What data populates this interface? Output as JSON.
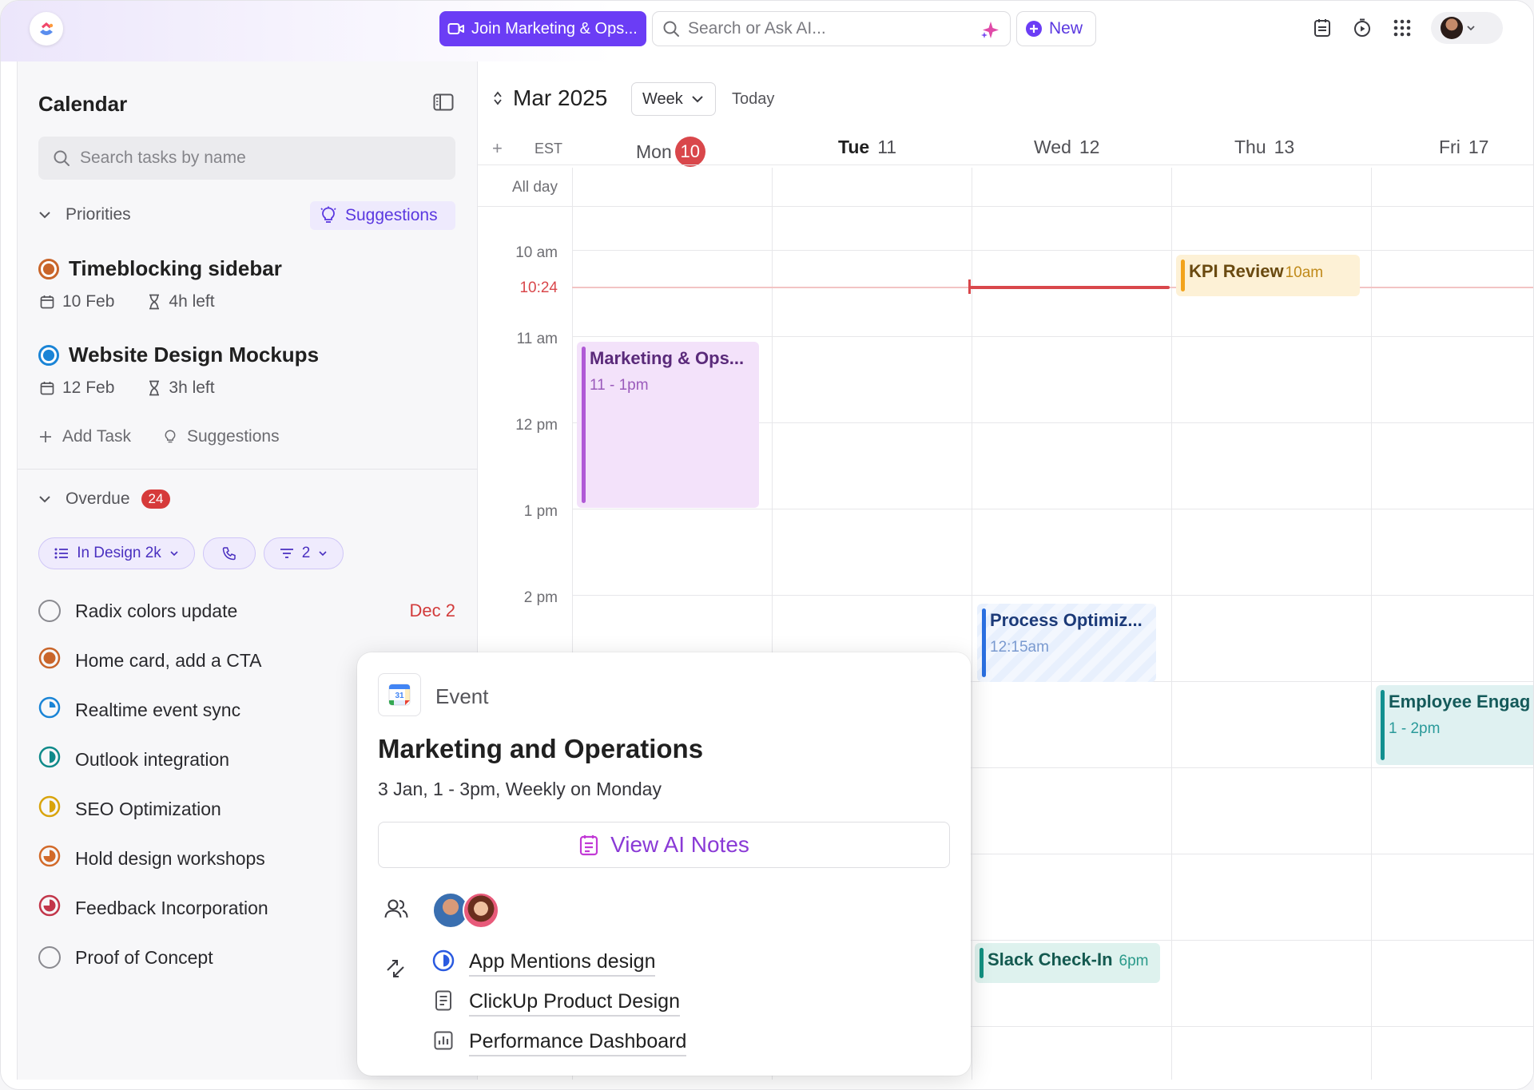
{
  "topbar": {
    "join_label": "Join Marketing & Ops...",
    "search_placeholder": "Search or Ask AI...",
    "new_label": "New",
    "accent": "#6b3df5"
  },
  "sidebar": {
    "title": "Calendar",
    "search_placeholder": "Search tasks by name",
    "priorities_label": "Priorities",
    "suggestions_label": "Suggestions",
    "priorities": [
      {
        "title": "Timeblocking sidebar",
        "date": "10 Feb",
        "left": "4h left",
        "status_color": "#c9652a"
      },
      {
        "title": "Website Design Mockups",
        "date": "12 Feb",
        "left": "3h left",
        "status_color": "#1a84d6"
      }
    ],
    "add_task_label": "Add Task",
    "suggestions_link": "Suggestions",
    "overdue_label": "Overdue",
    "overdue_count": "24",
    "filters": {
      "list_label": "In Design 2k",
      "filter_count": "2"
    },
    "overdue_tasks": [
      {
        "title": "Radix colors update",
        "due": "Dec 2",
        "icon": "empty-circle-icon"
      },
      {
        "title": "Home card, add a CTA",
        "due": "",
        "icon": "in-progress-orange-icon"
      },
      {
        "title": "Realtime event sync",
        "due": "",
        "icon": "quarter-blue-icon"
      },
      {
        "title": "Outlook integration",
        "due": "",
        "icon": "half-teal-icon"
      },
      {
        "title": "SEO Optimization",
        "due": "",
        "icon": "half-yellow-icon"
      },
      {
        "title": "Hold design workshops",
        "due": "",
        "icon": "three-quarter-orange-icon"
      },
      {
        "title": "Feedback Incorporation",
        "due": "",
        "icon": "three-quarter-red-icon"
      },
      {
        "title": "Proof of Concept",
        "due": "",
        "icon": "empty-circle-icon"
      }
    ]
  },
  "calendar": {
    "month": "Mar 2025",
    "view": "Week",
    "today_label": "Today",
    "timezone": "EST",
    "all_day_label": "All day",
    "days": [
      {
        "name": "Mon",
        "num": "10",
        "today": true
      },
      {
        "name": "Tue",
        "num": "11",
        "today": false
      },
      {
        "name": "Wed",
        "num": "12",
        "today": false
      },
      {
        "name": "Thu",
        "num": "13",
        "today": false
      },
      {
        "name": "Fri",
        "num": "17",
        "today": false
      }
    ],
    "hours": [
      "10 am",
      "11 am",
      "12 pm",
      "1 pm",
      "2 pm"
    ],
    "now_label": "10:24",
    "events": {
      "kpi": {
        "title": "KPI Review",
        "time": "10am"
      },
      "marketing": {
        "title": "Marketing & Ops...",
        "time": "11 - 1pm"
      },
      "process": {
        "title": "Process Optimiz...",
        "time": "12:15am"
      },
      "employee": {
        "title": "Employee Engag",
        "time": "1 - 2pm"
      },
      "slack": {
        "title": "Slack Check-In",
        "time": "6pm"
      }
    }
  },
  "popover": {
    "type": "Event",
    "title": "Marketing and Operations",
    "subtitle": "3 Jan, 1 - 3pm, Weekly on Monday",
    "ai_notes_label": "View AI Notes",
    "related": [
      {
        "title": "App Mentions design",
        "icon": "status-half-blue-icon"
      },
      {
        "title": "ClickUp Product Design",
        "icon": "doc-icon"
      },
      {
        "title": "Performance Dashboard",
        "icon": "dashboard-icon"
      }
    ]
  }
}
